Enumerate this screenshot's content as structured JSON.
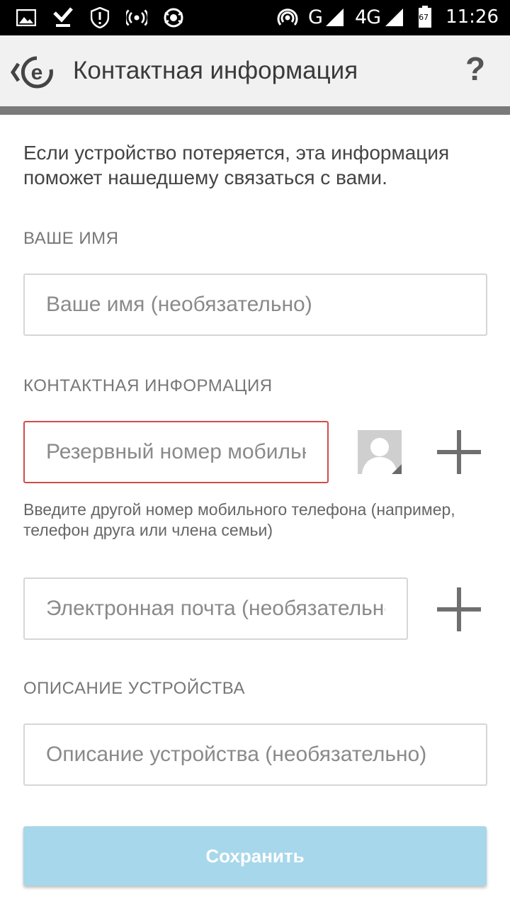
{
  "status_bar": {
    "icons_left": [
      "gallery-icon",
      "check-bag-icon",
      "shield-alert-icon",
      "broadcast-icon",
      "antivirus-icon"
    ],
    "icons_right": [
      "hotspot-icon",
      "signal-icon",
      "battery-icon"
    ],
    "network_g": "G",
    "network_4g": "4G",
    "battery": "67",
    "time": "11:26"
  },
  "app_bar": {
    "title": "Контактная информация",
    "help": "?"
  },
  "intro_text": "Если устройство потеряется, эта информация поможет нашедшему связаться с вами.",
  "name_section": {
    "label": "ВАШЕ ИМЯ",
    "placeholder": "Ваше имя (необязательно)"
  },
  "contact_section": {
    "label": "КОНТАКТНАЯ ИНФОРМАЦИЯ",
    "phone_placeholder": "Резервный номер мобильного телефона",
    "phone_hint": "Введите другой номер мобильного телефона (например, телефон друга или члена семьи)",
    "email_placeholder": "Электронная почта (необязательно)"
  },
  "device_section": {
    "label": "ОПИСАНИЕ УСТРОЙСТВА",
    "placeholder": "Описание устройства (необязательно)"
  },
  "save_button": "Сохранить",
  "colors": {
    "accent_disabled": "#a7d7ea",
    "error_border": "#d14b4b",
    "appbar_bg": "#f1f1f1"
  }
}
